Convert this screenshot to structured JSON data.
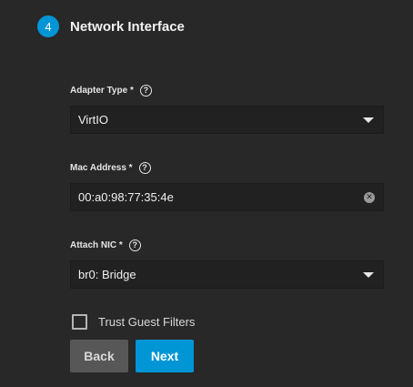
{
  "step": {
    "number": "4",
    "title": "Network Interface"
  },
  "fields": {
    "adapter_type": {
      "label": "Adapter Type *",
      "value": "VirtIO"
    },
    "mac_address": {
      "label": "Mac Address *",
      "value": "00:a0:98:77:35:4e"
    },
    "attach_nic": {
      "label": "Attach NIC *",
      "value": "br0: Bridge"
    }
  },
  "trust_guest_filters": {
    "label": "Trust Guest Filters",
    "checked": false
  },
  "buttons": {
    "back": "Back",
    "next": "Next"
  },
  "icons": {
    "help": "help-circle-icon",
    "dropdown": "chevron-down-icon",
    "clear": "clear-icon"
  },
  "colors": {
    "accent": "#0095d5",
    "background": "#282828",
    "input_bg": "#212121",
    "back_button": "#575757"
  }
}
